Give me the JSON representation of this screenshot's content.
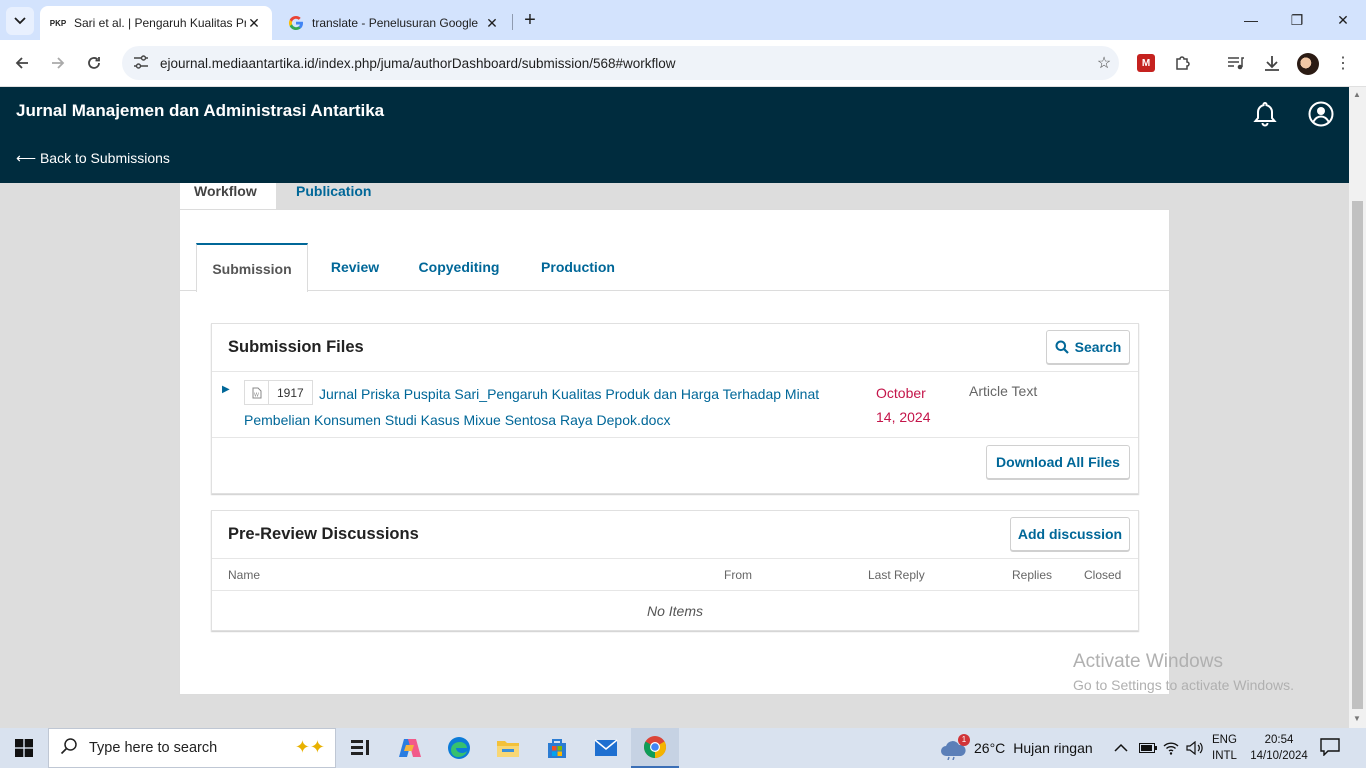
{
  "browser": {
    "tabs": [
      {
        "favicon": "PKP",
        "title": "Sari et al. | Pengaruh Kualitas Pr",
        "active": true
      },
      {
        "favicon": "G",
        "title": "translate - Penelusuran Google",
        "active": false
      }
    ],
    "url": "ejournal.mediaantartika.id/index.php/juma/authorDashboard/submission/568#workflow",
    "icons": {
      "tab_search": "chevron-down-icon",
      "new_tab": "plus-icon",
      "back": "arrow-left-icon",
      "forward": "arrow-right-icon",
      "reload": "reload-icon",
      "site_info": "tune-icon",
      "bookmark": "star-icon",
      "extension_red": "mendeley-icon",
      "extensions": "puzzle-icon",
      "media": "media-control-icon",
      "downloads": "download-icon",
      "profile": "avatar",
      "menu": "kebab-menu-icon"
    },
    "window_controls": {
      "minimize": "—",
      "restore": "❐",
      "close": "✕"
    }
  },
  "app": {
    "journal_title": "Jurnal Manajemen dan Administrasi Antartika",
    "back_link": "⟵ Back to Submissions",
    "icons": {
      "notifications": "bell-icon",
      "user": "user-circle-icon"
    }
  },
  "top_tabs": [
    {
      "label": "Workflow",
      "active": true
    },
    {
      "label": "Publication",
      "active": false
    }
  ],
  "stage_tabs": [
    {
      "label": "Submission",
      "active": true
    },
    {
      "label": "Review",
      "active": false
    },
    {
      "label": "Copyediting",
      "active": false
    },
    {
      "label": "Production",
      "active": false
    }
  ],
  "submission_files": {
    "title": "Submission Files",
    "search_label": "Search",
    "files": [
      {
        "id": "1917",
        "name": "Jurnal Priska Puspita Sari_Pengaruh Kualitas Produk dan Harga Terhadap Minat Pembelian Konsumen Studi Kasus Mixue Sentosa Raya Depok.docx",
        "date": "October 14, 2024",
        "type": "Article Text"
      }
    ],
    "download_all_label": "Download All Files"
  },
  "discussions": {
    "title": "Pre-Review Discussions",
    "add_label": "Add discussion",
    "columns": [
      "Name",
      "From",
      "Last Reply",
      "Replies",
      "Closed"
    ],
    "empty_text": "No Items"
  },
  "watermark": {
    "line1": "Activate Windows",
    "line2": "Go to Settings to activate Windows."
  },
  "taskbar": {
    "search_placeholder": "Type here to search",
    "weather": {
      "temp": "26°C",
      "condition": "Hujan ringan",
      "badge": "1"
    },
    "language": {
      "line1": "ENG",
      "line2": "INTL"
    },
    "clock": {
      "time": "20:54",
      "date": "14/10/2024"
    },
    "apps": [
      "task-view-icon",
      "copilot-icon",
      "edge-icon",
      "file-explorer-icon",
      "microsoft-store-icon",
      "mail-icon",
      "chrome-icon"
    ]
  },
  "colors": {
    "header_bg": "#002c3e",
    "link": "#006798",
    "date": "#c4154a",
    "page_bg": "#dddddd"
  }
}
